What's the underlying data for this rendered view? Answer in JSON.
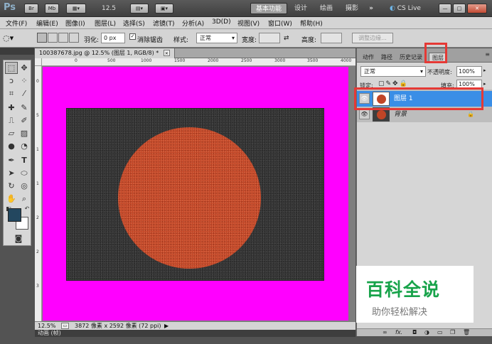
{
  "appbar": {
    "logo": "Ps",
    "btn_br": "Br",
    "btn_mb": "Mb",
    "zoom": "12.5",
    "workspaces": [
      "基本功能",
      "设计",
      "绘画",
      "摄影"
    ],
    "more": "»",
    "cslive": "CS Live",
    "win_min": "—",
    "win_max": "□",
    "win_close": "✕"
  },
  "menu": [
    "文件(F)",
    "编辑(E)",
    "图像(I)",
    "图层(L)",
    "选择(S)",
    "滤镜(T)",
    "分析(A)",
    "3D(D)",
    "视图(V)",
    "窗口(W)",
    "帮助(H)"
  ],
  "options": {
    "feather_label": "羽化:",
    "feather_value": "0 px",
    "antialias_label": "消除锯齿",
    "style_label": "样式:",
    "style_value": "正常",
    "width_label": "宽度:",
    "height_label": "高度:",
    "refine_edge": "调整边缘..."
  },
  "document": {
    "tab_title": "100387678.jpg @ 12.5% (图层 1, RGB/8) *",
    "tab_close": "✕",
    "ruler_h": [
      "0",
      "500",
      "1000",
      "1500",
      "2000",
      "2500",
      "3000",
      "3500",
      "4000"
    ],
    "ruler_v": [
      "0",
      "5",
      "1",
      "1",
      "2",
      "2",
      "3"
    ],
    "zoom": "12.5%",
    "doc_info": "3872 像素 x 2592 像素 (72 ppi)",
    "anim_label": "动画 (帧)"
  },
  "panel": {
    "tabs": [
      "动作",
      "路径",
      "历史记录",
      "图层"
    ],
    "blend_mode": "正常",
    "opacity_label": "不透明度:",
    "opacity_value": "100%",
    "lock_label": "锁定:",
    "fill_label": "填充:",
    "fill_value": "100%",
    "layers": [
      {
        "name": "图层 1",
        "selected": true
      },
      {
        "name": "背景",
        "selected": false
      }
    ],
    "footer_icons": [
      "link-icon",
      "fx-icon",
      "mask-icon",
      "adjustment-icon",
      "folder-icon",
      "new-layer-icon",
      "trash-icon"
    ],
    "footer_fx": "fx."
  },
  "watermark": {
    "title": "百科全说",
    "subtitle": "助你轻松解决"
  },
  "colors": {
    "canvas_bg": "#ff00ff",
    "disc": "#c14526",
    "selected_layer": "#3a8ee6",
    "highlight": "#e53935",
    "watermark_green": "#17a34a",
    "foreground": "#23475f",
    "background": "#ffffff"
  }
}
